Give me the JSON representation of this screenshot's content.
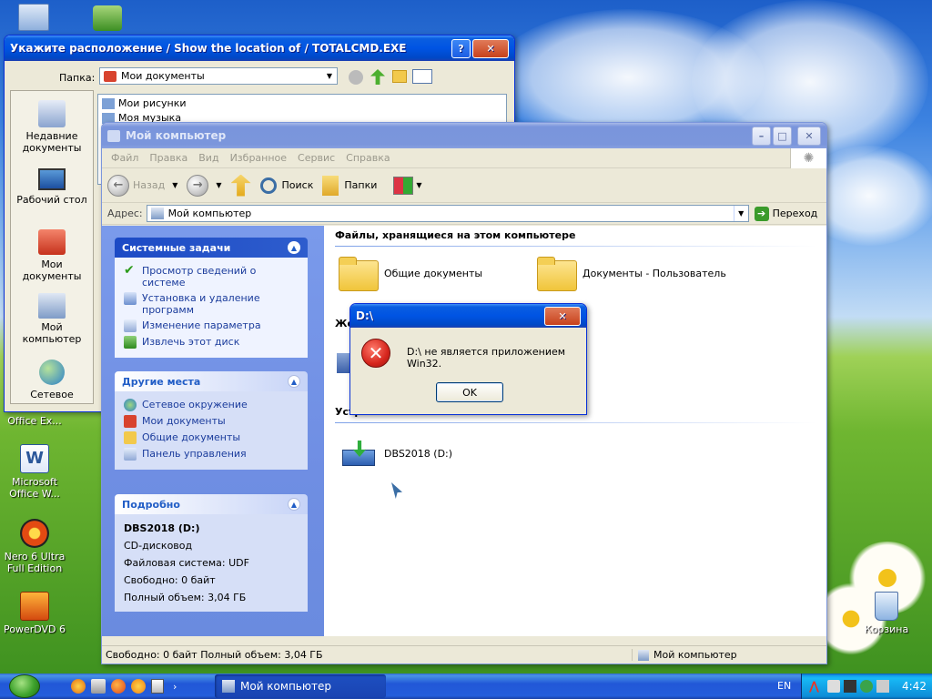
{
  "desktop": {
    "icons_left": [
      {
        "name": "office-excel",
        "label": "Office Ex..."
      },
      {
        "name": "ms-word",
        "label": "Microsoft\nOffice W..."
      },
      {
        "name": "nero",
        "label": "Nero 6 Ultra\nFull Edition"
      },
      {
        "name": "powerdvd",
        "label": "PowerDVD 6"
      }
    ],
    "recycle_bin_label": "Корзина"
  },
  "save_dialog": {
    "title": "Укажите расположение / Show the location of / TOTALCMD.EXE",
    "folder_label": "Папка:",
    "folder_value": "Мои документы",
    "places": [
      {
        "name": "recent",
        "label": "Недавние\nдокументы"
      },
      {
        "name": "desktop",
        "label": "Рабочий стол"
      },
      {
        "name": "mydocs",
        "label": "Мои документы"
      },
      {
        "name": "mycomp",
        "label": "Мой\nкомпьютер"
      },
      {
        "name": "network",
        "label": "Сетевое"
      }
    ],
    "list_items": [
      "Мои рисунки",
      "Моя музыка"
    ]
  },
  "explorer": {
    "title": "Мой компьютер",
    "menu": [
      "Файл",
      "Правка",
      "Вид",
      "Избранное",
      "Сервис",
      "Справка"
    ],
    "toolbar": {
      "back": "Назад",
      "search": "Поиск",
      "folders": "Папки"
    },
    "address_label": "Адрес:",
    "address_value": "Мой компьютер",
    "go_label": "Переход",
    "system_tasks": {
      "title": "Системные задачи",
      "items": [
        "Просмотр сведений о системе",
        "Установка и удаление программ",
        "Изменение параметра",
        "Извлечь этот диск"
      ]
    },
    "other_places": {
      "title": "Другие места",
      "items": [
        "Сетевое окружение",
        "Мои документы",
        "Общие документы",
        "Панель управления"
      ]
    },
    "details": {
      "title": "Подробно",
      "name": "DBS2018 (D:)",
      "type": "CD-дисковод",
      "fs": "Файловая система: UDF",
      "free": "Свободно: 0 байт",
      "total": "Полный объем: 3,04 ГБ"
    },
    "files_section": "Файлы, хранящиеся на этом компьютере",
    "files": [
      "Общие документы",
      "Документы - Пользователь"
    ],
    "hdd_section_partial": "Же",
    "removable_section": "Устройства со съемными носителями",
    "drive": "DBS2018 (D:)",
    "status_left": "Свободно: 0 байт Полный объем: 3,04 ГБ",
    "status_right": "Мой компьютер"
  },
  "error_dialog": {
    "title": "D:\\",
    "message": "D:\\ не является приложением Win32.",
    "ok": "OK"
  },
  "taskbar": {
    "task_label": "Мой компьютер",
    "lang": "EN",
    "clock": "4:42"
  },
  "colors": {
    "xp_blue": "#0054e3",
    "error_red": "#d6261d",
    "link_blue": "#1b3c9c"
  }
}
